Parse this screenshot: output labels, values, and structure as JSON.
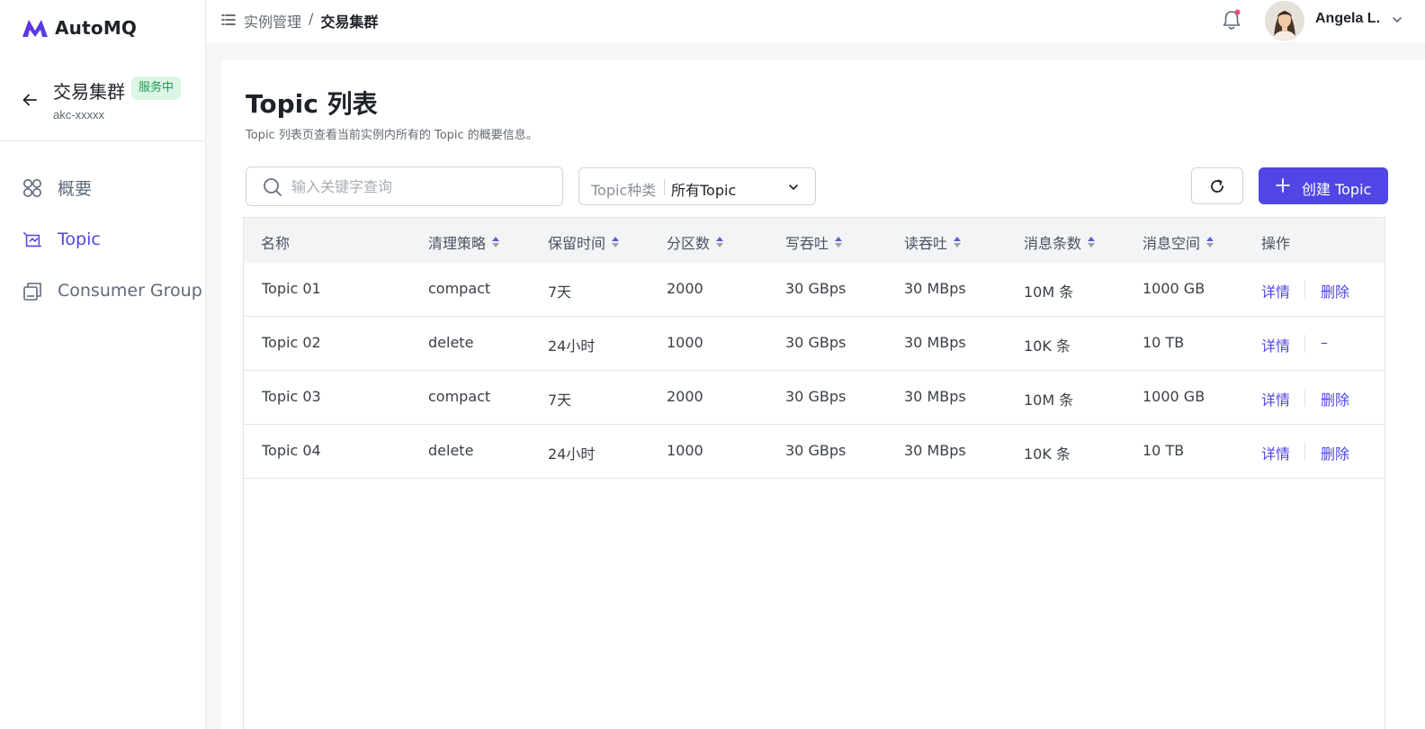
{
  "brand": {
    "name": "AutoMQ",
    "color": "#4f46e5"
  },
  "cluster": {
    "name": "交易集群",
    "status": "服务中",
    "id": "akc-xxxxx"
  },
  "nav": [
    {
      "label": "概要",
      "icon": "overview-grid-icon",
      "active": false
    },
    {
      "label": "Topic",
      "icon": "topic-icon",
      "active": true
    },
    {
      "label": "Consumer Group",
      "icon": "consumer-group-icon",
      "active": false
    }
  ],
  "topbar": {
    "breadcrumb": [
      "实例管理",
      "/",
      "交易集群"
    ],
    "user_name": "Angela L."
  },
  "page": {
    "title": "Topic 列表",
    "description": "Topic 列表页查看当前实例内所有的 Topic 的概要信息。"
  },
  "toolbar": {
    "search_placeholder": "输入关键字查询",
    "filter_label": "Topic种类",
    "filter_value": "所有Topic",
    "create_label": "创建 Topic"
  },
  "table": {
    "columns": [
      "名称",
      "清理策略",
      "保留时间",
      "分区数",
      "写吞吐",
      "读吞吐",
      "消息条数",
      "消息空间",
      "操作"
    ],
    "rows": [
      {
        "name": "Topic 01",
        "policy": "compact",
        "retention": "7天",
        "partitions": "2000",
        "write": "30 GBps",
        "read": "30 MBps",
        "messages": "10M 条",
        "space": "1000 GB",
        "detail": "详情",
        "delete": "删除"
      },
      {
        "name": "Topic 02",
        "policy": "delete",
        "retention": "24小时",
        "partitions": "1000",
        "write": "30 GBps",
        "read": "30 MBps",
        "messages": "10K 条",
        "space": "10 TB",
        "detail": "详情",
        "delete": "–"
      },
      {
        "name": "Topic 03",
        "policy": "compact",
        "retention": "7天",
        "partitions": "2000",
        "write": "30 GBps",
        "read": "30 MBps",
        "messages": "10M 条",
        "space": "1000 GB",
        "detail": "详情",
        "delete": "删除"
      },
      {
        "name": "Topic 04",
        "policy": "delete",
        "retention": "24小时",
        "partitions": "1000",
        "write": "30 GBps",
        "read": "30 MBps",
        "messages": "10K 条",
        "space": "10 TB",
        "detail": "详情",
        "delete": "删除"
      }
    ]
  }
}
